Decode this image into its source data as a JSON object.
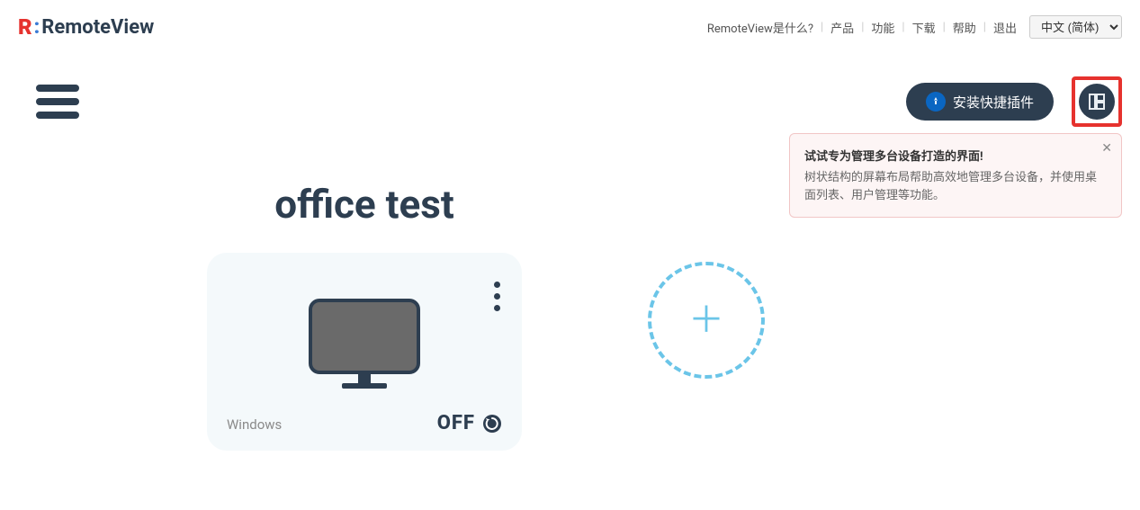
{
  "header": {
    "logo_text": "RemoteView",
    "nav": [
      "RemoteView是什么?",
      "产品",
      "功能",
      "下载",
      "帮助",
      "退出"
    ],
    "language": "中文 (简体)"
  },
  "toolbar": {
    "install_plugin_label": "安装快捷插件"
  },
  "tooltip": {
    "title": "试试专为管理多台设备打造的界面!",
    "desc": "树状结构的屏幕布局帮助高效地管理多台设备，并使用桌面列表、用户管理等功能。"
  },
  "group": {
    "title": "office test"
  },
  "device": {
    "os": "Windows",
    "status": "OFF"
  }
}
